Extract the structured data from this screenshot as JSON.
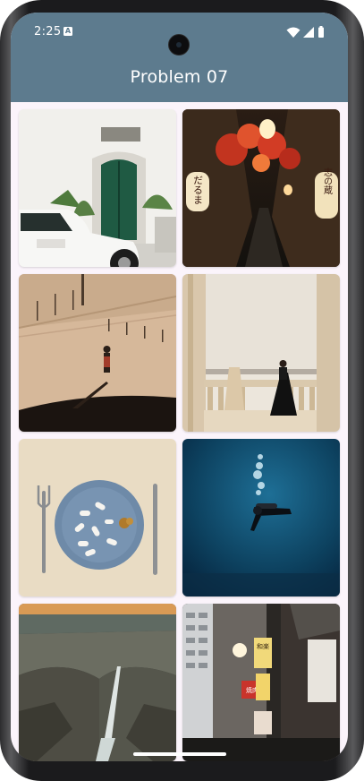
{
  "status_bar": {
    "time": "2:25",
    "notification_glyph": "A",
    "icons": [
      "wifi-icon",
      "signal-icon",
      "battery-icon"
    ]
  },
  "app_bar": {
    "title": "Problem 07",
    "color": "#5d7b8e"
  },
  "photo_grid": [
    {
      "name": "photo-white-building-car",
      "subject": "white building with green door and vintage car"
    },
    {
      "name": "photo-lantern-alley",
      "subject": "night alley with lanterns",
      "signs": [
        "だるま",
        "志の蔵"
      ]
    },
    {
      "name": "photo-street-shadow",
      "subject": "person walking in sunlit street"
    },
    {
      "name": "photo-woman-balcony",
      "subject": "woman in black dress on balcony"
    },
    {
      "name": "photo-pills-plate",
      "subject": "pills on blue plate with fork and knife"
    },
    {
      "name": "photo-scuba-diver",
      "subject": "scuba diver in deep blue water"
    },
    {
      "name": "photo-canyon-waterfall",
      "subject": "canyon with waterfall"
    },
    {
      "name": "photo-city-street-signs",
      "subject": "city street with hanging signs",
      "signs": [
        "和楽",
        "焼肉"
      ]
    }
  ]
}
